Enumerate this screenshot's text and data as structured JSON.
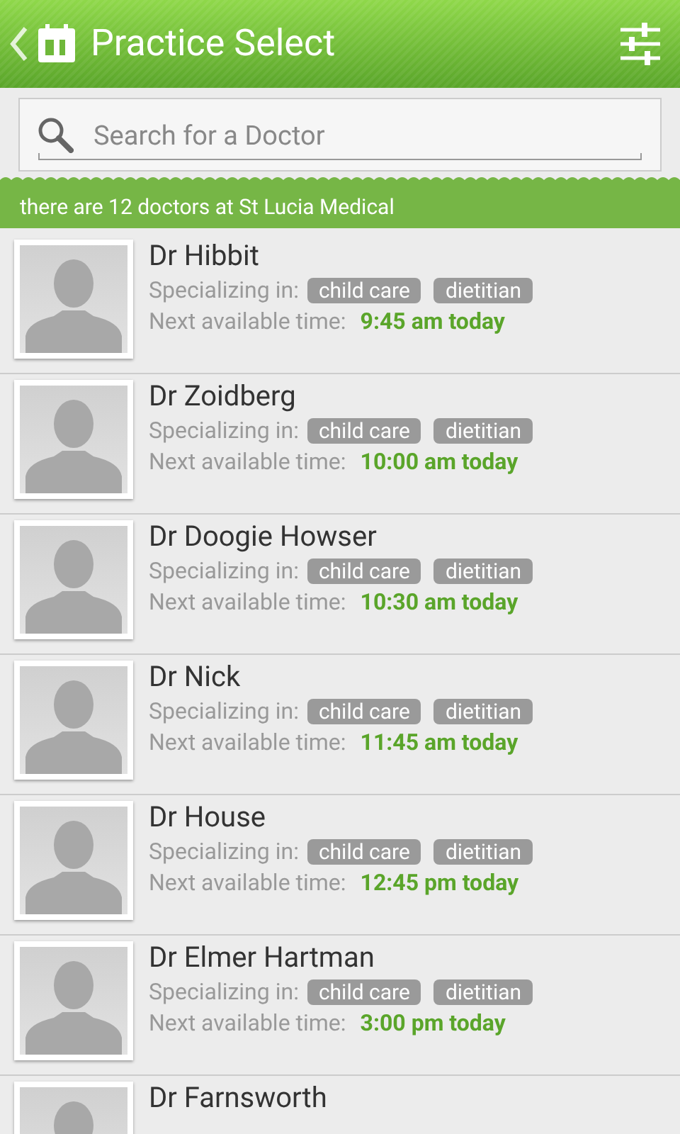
{
  "header": {
    "title": "Practice Select"
  },
  "search": {
    "placeholder": "Search for a Doctor"
  },
  "banner": "there are 12 doctors at St Lucia Medical",
  "doctors": [
    {
      "name": "Dr Hibbit",
      "specializing_label": "Specializing in:",
      "specialties": [
        "child care",
        "dietitian"
      ],
      "next_label": "Next available time:",
      "next_time": "9:45 am today"
    },
    {
      "name": "Dr Zoidberg",
      "specializing_label": "Specializing in:",
      "specialties": [
        "child care",
        "dietitian"
      ],
      "next_label": "Next available time:",
      "next_time": "10:00 am today"
    },
    {
      "name": "Dr Doogie Howser",
      "specializing_label": "Specializing in:",
      "specialties": [
        "child care",
        "dietitian"
      ],
      "next_label": "Next available time:",
      "next_time": "10:30 am today"
    },
    {
      "name": "Dr Nick",
      "specializing_label": "Specializing in:",
      "specialties": [
        "child care",
        "dietitian"
      ],
      "next_label": "Next available time:",
      "next_time": "11:45 am today"
    },
    {
      "name": "Dr House",
      "specializing_label": "Specializing in:",
      "specialties": [
        "child care",
        "dietitian"
      ],
      "next_label": "Next available time:",
      "next_time": "12:45 pm today"
    },
    {
      "name": "Dr Elmer Hartman",
      "specializing_label": "Specializing in:",
      "specialties": [
        "child care",
        "dietitian"
      ],
      "next_label": "Next available time:",
      "next_time": "3:00 pm today"
    },
    {
      "name": "Dr Farnsworth"
    }
  ]
}
